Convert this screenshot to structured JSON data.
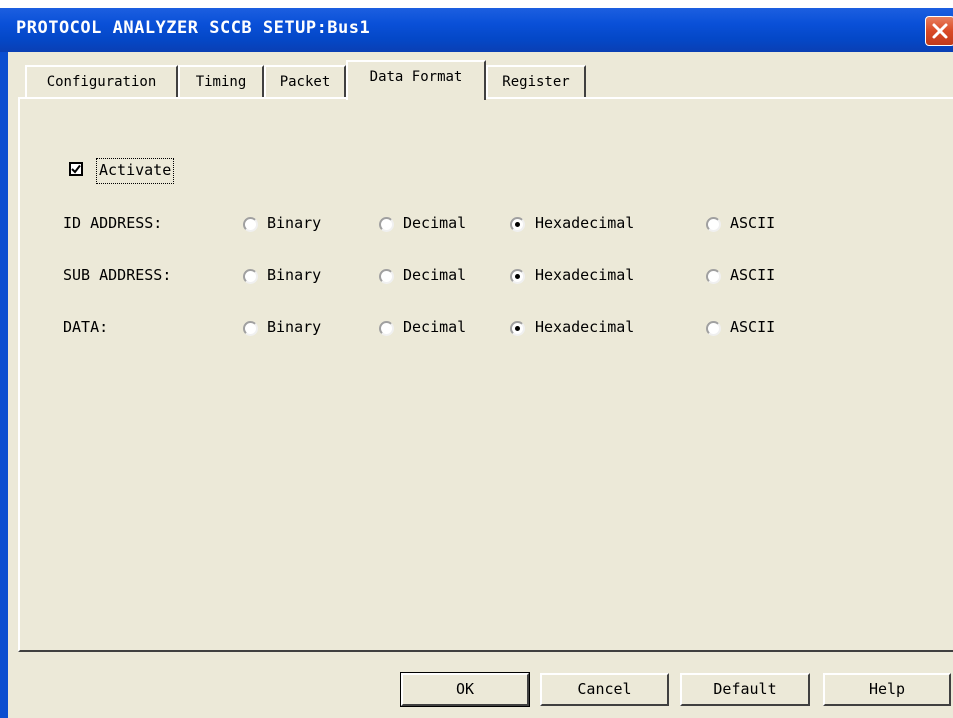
{
  "window": {
    "title": "PROTOCOL ANALYZER SCCB SETUP:Bus1",
    "close_icon": "close-icon"
  },
  "tabs": [
    {
      "label": "Configuration",
      "active": false
    },
    {
      "label": "Timing",
      "active": false
    },
    {
      "label": "Packet",
      "active": false
    },
    {
      "label": "Data Format",
      "active": true
    },
    {
      "label": "Register",
      "active": false
    }
  ],
  "activate": {
    "label": "Activate",
    "checked": true
  },
  "format_rows": [
    {
      "label": "ID ADDRESS:",
      "selected": "Hexadecimal"
    },
    {
      "label": "SUB ADDRESS:",
      "selected": "Hexadecimal"
    },
    {
      "label": "DATA:",
      "selected": "Hexadecimal"
    }
  ],
  "format_options": [
    "Binary",
    "Decimal",
    "Hexadecimal",
    "ASCII"
  ],
  "buttons": {
    "ok": "OK",
    "cancel": "Cancel",
    "default": "Default",
    "help": "Help"
  }
}
